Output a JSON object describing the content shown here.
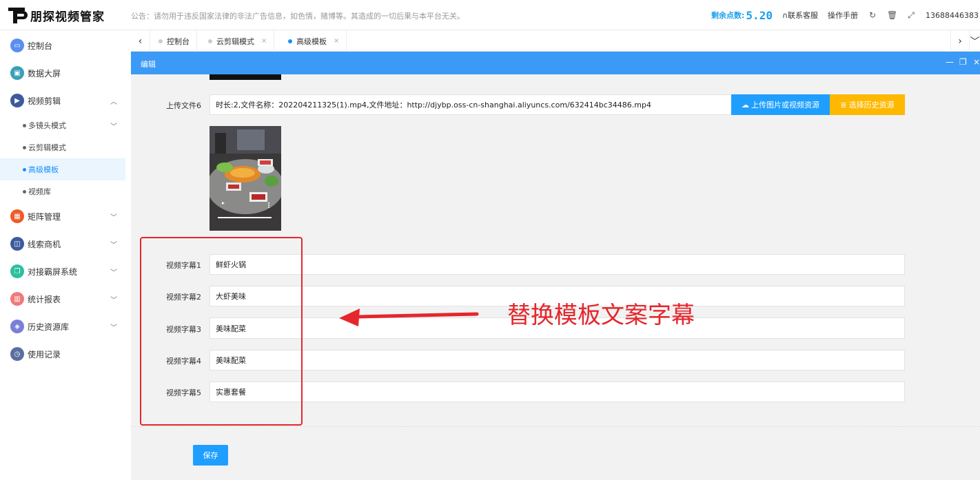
{
  "app": {
    "name": "朋探视频管家",
    "notice": "公告：请勿用于违反国家法律的非法广告信息，如色情，赌博等。其造成的一切后果与本平台无关。",
    "points_label": "剩余点数:",
    "points_value": "5.20",
    "contact": "联系客服",
    "manual": "操作手册",
    "phone": "13688446383"
  },
  "sidebar": {
    "items": [
      {
        "label": "控制台",
        "color": "#5a8ff0"
      },
      {
        "label": "数据大屏",
        "color": "#3aa0b8"
      },
      {
        "label": "视频剪辑",
        "color": "#3d5a9e"
      },
      {
        "label": "矩阵管理",
        "color": "#f05a28"
      },
      {
        "label": "线索商机",
        "color": "#3d5a9e"
      },
      {
        "label": "对接霸屏系统",
        "color": "#2dc0a0"
      },
      {
        "label": "统计报表",
        "color": "#f07a7a"
      },
      {
        "label": "历史资源库",
        "color": "#7a7fd8"
      },
      {
        "label": "使用记录",
        "color": "#5a6fa0"
      }
    ],
    "sub_items": [
      "多镜头模式",
      "云剪辑模式",
      "高级模板",
      "视频库"
    ]
  },
  "tabs": [
    "控制台",
    "云剪辑模式",
    "高级模板"
  ],
  "dialog": {
    "title": "编辑"
  },
  "form": {
    "upload_label": "上传文件6",
    "upload_value": "时长:2,文件名称：202204211325(1).mp4,文件地址：http://djybp.oss-cn-shanghai.aliyuncs.com/632414bc34486.mp4",
    "upload_button": "上传图片或视频资源",
    "history_button": "选择历史资源",
    "subtitles": [
      {
        "label": "视频字幕1",
        "value": "鲜虾火锅"
      },
      {
        "label": "视频字幕2",
        "value": "大虾美味"
      },
      {
        "label": "视频字幕3",
        "value": "美味配菜"
      },
      {
        "label": "视频字幕4",
        "value": "美味配菜"
      },
      {
        "label": "视频字幕5",
        "value": "实惠套餐"
      }
    ],
    "save": "保存"
  },
  "annotation": {
    "text": "替换模板文案字幕",
    "color": "#e5262c"
  }
}
